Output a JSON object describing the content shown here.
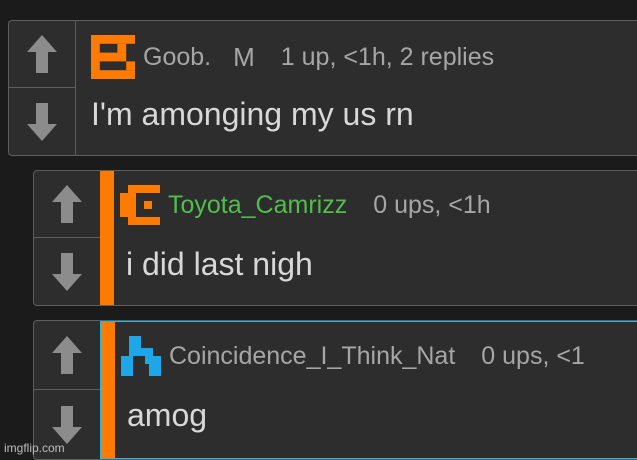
{
  "colors": {
    "background": "#1b1b1b",
    "card": "#2d2d2d",
    "orange_accent": "#ff7a00",
    "cyan_highlight": "#22b8e8",
    "green_username": "#4fbf4a",
    "meta_text": "#a6a6a6",
    "body_text": "#d8d8d8"
  },
  "comments": [
    {
      "username": "Goob.",
      "flair": "M",
      "meta": "1 up, <1h, 2 replies",
      "text": "I'm amonging my us rn",
      "avatar_icon": "orange-pixel-avatar-icon"
    },
    {
      "username": "Toyota_Camrizz",
      "meta": "0 ups, <1h",
      "text": "i did last nigh",
      "avatar_icon": "orange-pixel-avatar-icon"
    },
    {
      "username": "Coincidence_I_Think_Nat",
      "meta": "0 ups, <1",
      "text": "amog",
      "avatar_icon": "blue-pixel-avatar-icon"
    }
  ],
  "icons": {
    "upvote": "up-arrow-icon",
    "downvote": "down-arrow-icon"
  },
  "watermark": "imgflip.com"
}
